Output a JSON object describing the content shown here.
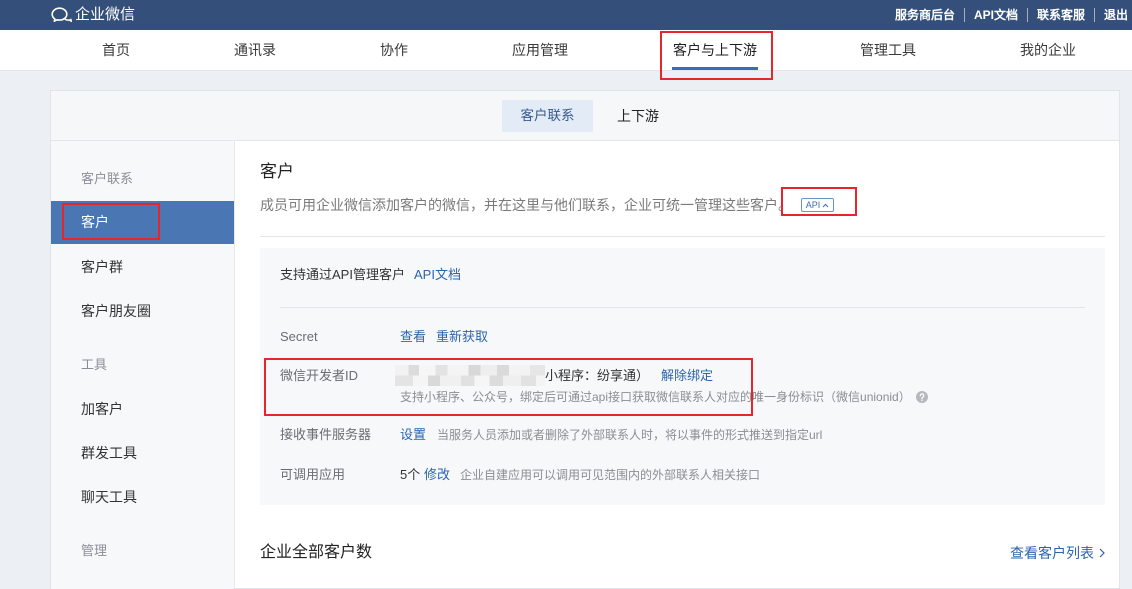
{
  "topbar": {
    "logo_text": "企业微信",
    "links": [
      "服务商后台",
      "API文档",
      "联系客服",
      "退出"
    ]
  },
  "nav": {
    "items": [
      {
        "label": "首页"
      },
      {
        "label": "通讯录"
      },
      {
        "label": "协作"
      },
      {
        "label": "应用管理"
      },
      {
        "label": "客户与上下游",
        "selected": true
      },
      {
        "label": "管理工具"
      },
      {
        "label": "我的企业"
      }
    ]
  },
  "subtabs": {
    "items": [
      {
        "label": "客户联系",
        "selected": true
      },
      {
        "label": "上下游"
      }
    ]
  },
  "sidebar": {
    "sections": [
      {
        "title": "客户联系",
        "items": [
          {
            "label": "客户",
            "selected": true
          },
          {
            "label": "客户群"
          },
          {
            "label": "客户朋友圈"
          }
        ]
      },
      {
        "title": "工具",
        "items": [
          {
            "label": "加客户"
          },
          {
            "label": "群发工具"
          },
          {
            "label": "聊天工具"
          }
        ]
      },
      {
        "title": "管理",
        "items": []
      }
    ]
  },
  "main": {
    "title": "客户",
    "description": "成员可用企业微信添加客户的微信，并在这里与他们联系，企业可统一管理这些客户。",
    "api_badge": {
      "label": "API",
      "icon": "chevron-up-icon"
    },
    "api_panel": {
      "heading": "支持通过API管理客户",
      "doc_link": "API文档",
      "secret": {
        "label": "Secret",
        "view": "查看",
        "regenerate": "重新获取"
      },
      "wechat_developer_id": {
        "label": "微信开发者ID",
        "redacted": true,
        "bound_app": "小程序：纷享通）",
        "unbind": "解除绑定",
        "hint": "支持小程序、公众号，绑定后可通过api接口获取微信联系人对应的唯一身份标识（微信unionid）",
        "hint_icon": "question-circle-icon"
      },
      "event_server": {
        "label": "接收事件服务器",
        "action": "设置",
        "hint": "当服务人员添加或者删除了外部联系人时，将以事件的形式推送到指定url"
      },
      "callable_apps": {
        "label": "可调用应用",
        "count": "5个",
        "action": "修改",
        "hint": "企业自建应用可以调用可见范围内的外部联系人相关接口"
      }
    },
    "total_customers": {
      "heading": "企业全部客户数",
      "link": "查看客户列表",
      "icon": "chevron-right-icon"
    }
  },
  "icons": {
    "logo": "wecom-logo-icon"
  },
  "colors": {
    "topbar": "#34507a",
    "accent": "#3a6db4",
    "link": "#2c64ad",
    "sidebar_active": "#4a77b4",
    "subtab_active_bg": "#e2ebf6",
    "annotation": "#e5262a"
  }
}
